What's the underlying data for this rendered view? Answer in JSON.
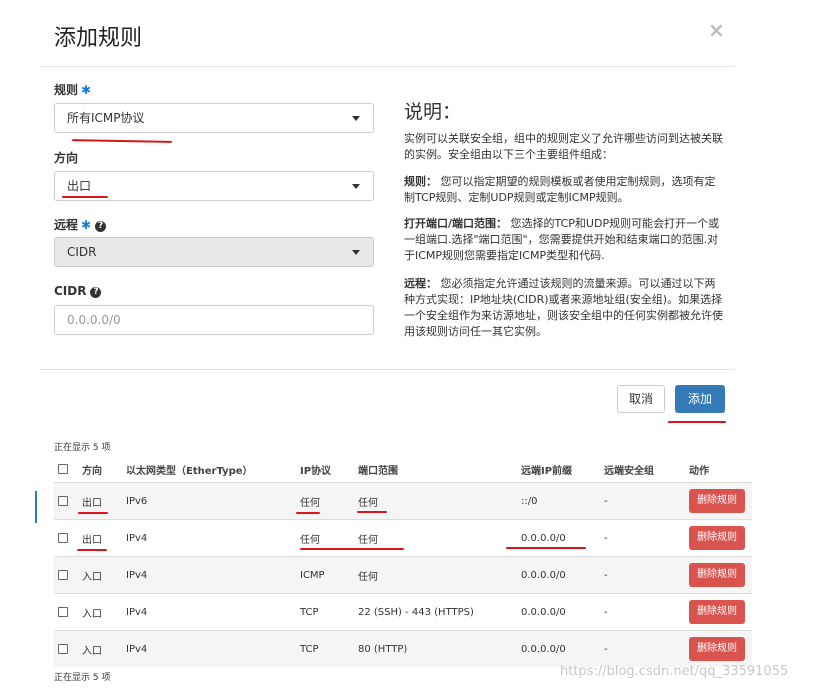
{
  "modal": {
    "title": "添加规则",
    "close_symbol": "×",
    "cancel_label": "取消",
    "submit_label": "添加"
  },
  "form": {
    "rule": {
      "label": "规则",
      "required_mark": "✱",
      "value": "所有ICMP协议"
    },
    "direction": {
      "label": "方向",
      "value": "出口"
    },
    "remote": {
      "label": "远程",
      "required_mark": "✱",
      "help_icon": "?",
      "value": "CIDR"
    },
    "cidr": {
      "label": "CIDR",
      "help_icon": "?",
      "placeholder": "0.0.0.0/0"
    }
  },
  "help": {
    "title": "说明：",
    "intro": "实例可以关联安全组，组中的规则定义了允许哪些访问到达被关联的实例。安全组由以下三个主要组件组成：",
    "rule_term": "规则：",
    "rule_text": "您可以指定期望的规则模板或者使用定制规则，选项有定制TCP规则、定制UDP规则或定制ICMP规则。",
    "port_term": "打开端口/端口范围：",
    "port_text": "您选择的TCP和UDP规则可能会打开一个或一组端口.选择\"端口范围\"，您需要提供开始和结束端口的范围.对于ICMP规则您需要指定ICMP类型和代码.",
    "remote_term": "远程：",
    "remote_text": "您必须指定允许通过该规则的流量来源。可以通过以下两种方式实现：IP地址块(CIDR)或者来源地址组(安全组)。如果选择一个安全组作为来访源地址，则该安全组中的任何实例都被允许使用该规则访问任一其它实例。"
  },
  "table": {
    "count_top": "正在显示 5 项",
    "count_bottom": "正在显示 5 项",
    "headers": {
      "direction": "方向",
      "ethertype": "以太网类型（EtherType）",
      "protocol": "IP协议",
      "port_range": "端口范围",
      "remote_prefix": "远端IP前缀",
      "remote_group": "远端安全组",
      "actions": "动作"
    },
    "rows": [
      {
        "direction": "出口",
        "ethertype": "IPv6",
        "protocol": "任何",
        "port_range": "任何",
        "remote_prefix": "::/0",
        "remote_group": "-",
        "action": "删除规则"
      },
      {
        "direction": "出口",
        "ethertype": "IPv4",
        "protocol": "任何",
        "port_range": "任何",
        "remote_prefix": "0.0.0.0/0",
        "remote_group": "-",
        "action": "删除规则"
      },
      {
        "direction": "入口",
        "ethertype": "IPv4",
        "protocol": "ICMP",
        "port_range": "任何",
        "remote_prefix": "0.0.0.0/0",
        "remote_group": "-",
        "action": "删除规则"
      },
      {
        "direction": "入口",
        "ethertype": "IPv4",
        "protocol": "TCP",
        "port_range": "22 (SSH) - 443 (HTTPS)",
        "remote_prefix": "0.0.0.0/0",
        "remote_group": "-",
        "action": "删除规则"
      },
      {
        "direction": "入口",
        "ethertype": "IPv4",
        "protocol": "TCP",
        "port_range": "80 (HTTP)",
        "remote_prefix": "0.0.0.0/0",
        "remote_group": "-",
        "action": "删除规则"
      }
    ]
  },
  "watermark": "https://blog.csdn.net/qq_33591055",
  "colors": {
    "primary": "#337ab7",
    "danger": "#d9534f",
    "required": "#1a7cd5",
    "annotation": "#d9161a"
  }
}
